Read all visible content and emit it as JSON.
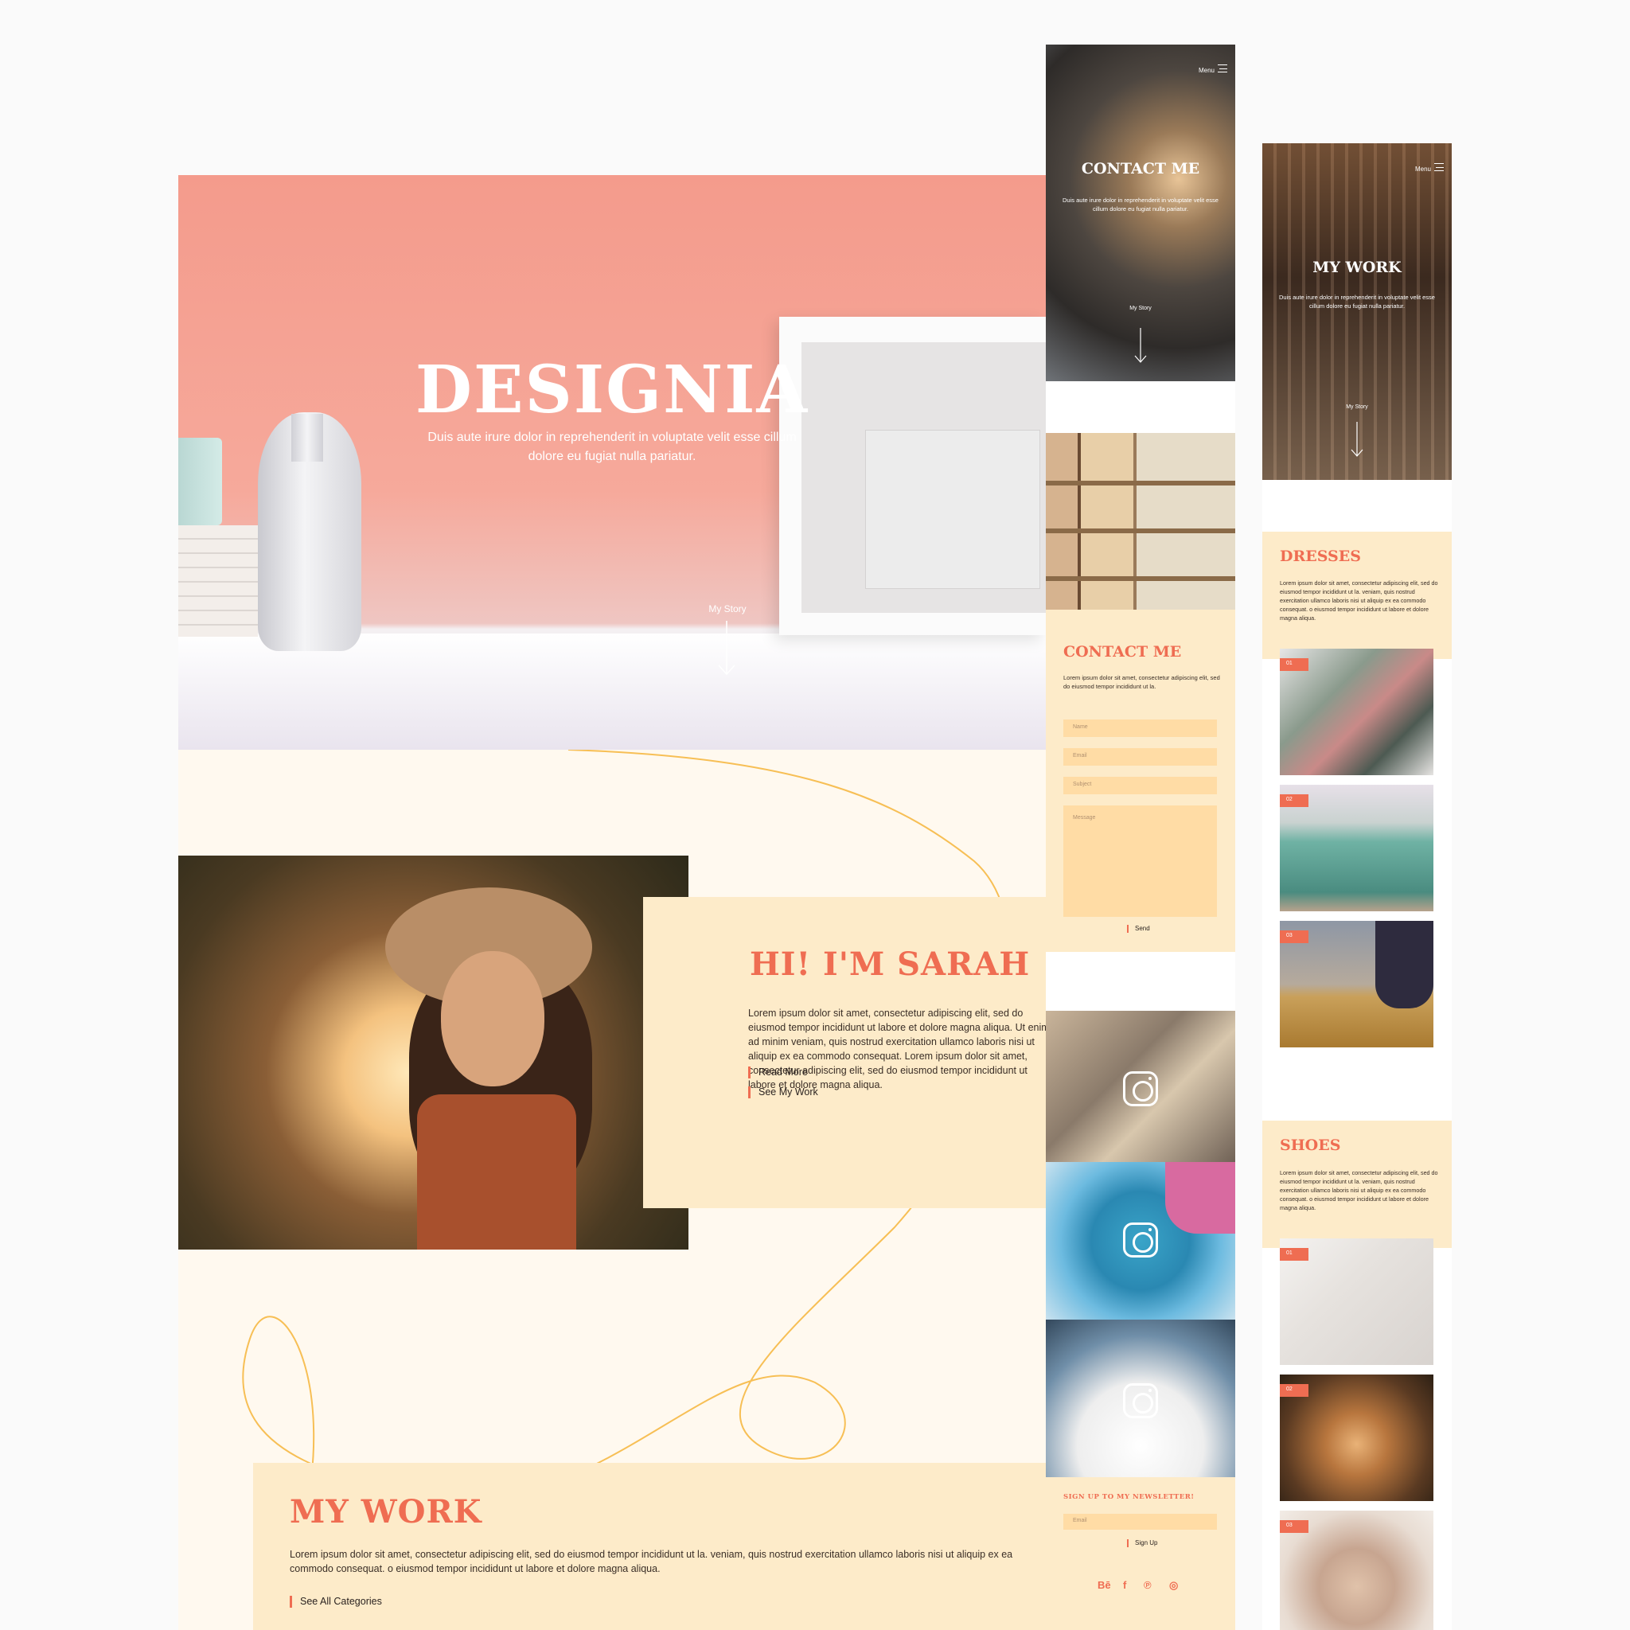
{
  "desktop": {
    "hero": {
      "title": "DESIGNIA",
      "subtitle": "Duis aute irure dolor in reprehenderit in voluptate velit esse cillum dolore eu fugiat nulla pariatur.",
      "story_link": "My Story"
    },
    "about": {
      "title": "HI! I'M SARAH",
      "text": "Lorem ipsum dolor sit amet, consectetur adipiscing elit, sed do eiusmod tempor incididunt ut labore et dolore magna aliqua. Ut enim ad minim veniam, quis nostrud exercitation ullamco laboris nisi ut aliquip ex ea commodo consequat. Lorem ipsum dolor sit amet, consectetur adipiscing elit, sed do eiusmod tempor incididunt ut labore et dolore magna aliqua.",
      "read_more": "Read More",
      "see_work": "See My Work"
    },
    "work": {
      "title": "MY WORK",
      "text": "Lorem ipsum dolor sit amet, consectetur adipiscing elit, sed do eiusmod tempor incididunt ut la.  veniam, quis nostrud exercitation ullamco laboris nisi ut aliquip ex ea commodo consequat.  o eiusmod tempor incididunt ut labore et dolore magna aliqua.",
      "link": "See All Categories"
    }
  },
  "contact_phone": {
    "menu_label": "Menu",
    "hero": {
      "title": "CONTACT ME",
      "subtitle": "Duis aute irure dolor in reprehenderit in voluptate velit esse cillum dolore eu fugiat nulla pariatur.",
      "story_link": "My Story"
    },
    "form": {
      "title": "CONTACT ME",
      "text": "Lorem ipsum dolor sit amet, consectetur adipiscing elit, sed do eiusmod tempor incididunt ut la.",
      "name_placeholder": "Name",
      "email_placeholder": "Email",
      "subject_placeholder": "Subject",
      "message_placeholder": "Message",
      "send_label": "Send"
    },
    "newsletter": {
      "title": "SIGN UP TO MY NEWSLETTER!",
      "email_placeholder": "Email",
      "signup_label": "Sign Up"
    },
    "social": [
      "Bē",
      "f",
      "℗",
      "◎"
    ]
  },
  "work_phone": {
    "menu_label": "Menu",
    "hero": {
      "title": "MY WORK",
      "subtitle": "Duis aute irure dolor in reprehenderit in voluptate velit esse cillum dolore eu fugiat nulla pariatur.",
      "story_link": "My Story"
    },
    "categories": [
      {
        "title": "DRESSES",
        "text": "Lorem ipsum dolor sit amet, consectetur adipiscing elit, sed do eiusmod tempor incididunt ut la.  veniam, quis nostrud exercitation ullamco laboris nisi ut aliquip ex ea commodo consequat. o eiusmod tempor incididunt ut labore et dolore magna aliqua.",
        "badges": [
          "01",
          "02",
          "03"
        ]
      },
      {
        "title": "SHOES",
        "text": "Lorem ipsum dolor sit amet, consectetur adipiscing elit, sed do eiusmod tempor incididunt ut la.  veniam, quis nostrud exercitation ullamco laboris nisi ut aliquip ex ea commodo consequat. o eiusmod tempor incididunt ut labore et dolore magna aliqua.",
        "badges": [
          "01",
          "02",
          "03"
        ]
      }
    ]
  },
  "colors": {
    "accent": "#ef6d52",
    "cream": "#fdebc9",
    "background": "#fff9ef",
    "field": "#ffdca5"
  },
  "icons": [
    "arrow-down-icon",
    "menu-icon",
    "instagram-icon",
    "behance-icon",
    "facebook-icon",
    "pinterest-icon"
  ]
}
